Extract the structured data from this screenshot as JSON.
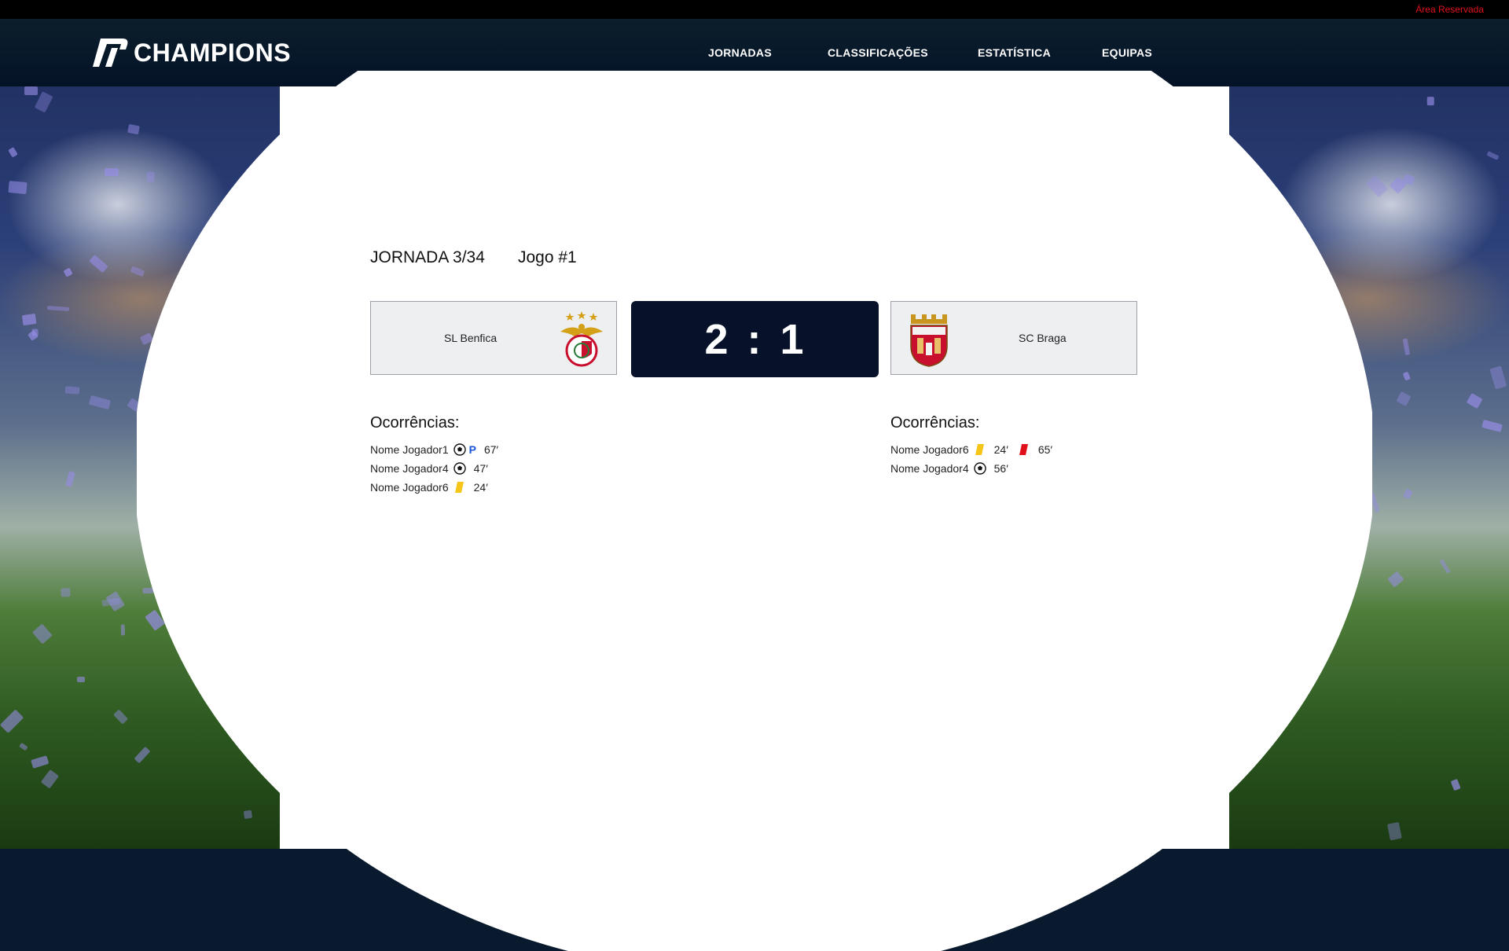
{
  "topbar": {
    "reserved_label": "Área Reservada"
  },
  "header": {
    "logo_text": "CHAMPIONS",
    "nav": [
      "JORNADAS",
      "CLASSIFICAÇÕES",
      "ESTATÍSTICA",
      "EQUIPAS"
    ]
  },
  "match": {
    "jornada_label": "JORNADA 3/34",
    "game_label": "Jogo #1",
    "home_team": "SL Benfica",
    "away_team": "SC Braga",
    "home_score": "2",
    "separator": ":",
    "away_score": "1"
  },
  "occurrences": {
    "title": "Ocorrências:",
    "home": [
      {
        "player": "Nome Jogador1",
        "events": [
          {
            "icon": "goal-ball-icon",
            "penalty": "P",
            "minute": "67′"
          }
        ]
      },
      {
        "player": "Nome Jogador4",
        "events": [
          {
            "icon": "goal-ball-icon",
            "minute": "47′"
          }
        ]
      },
      {
        "player": "Nome Jogador6",
        "events": [
          {
            "icon": "yellow-card-icon",
            "minute": "24′"
          }
        ]
      }
    ],
    "away": [
      {
        "player": "Nome Jogador6",
        "events": [
          {
            "icon": "yellow-card-icon",
            "minute": "24′"
          },
          {
            "icon": "red-card-icon",
            "minute": "65′"
          }
        ]
      },
      {
        "player": "Nome Jogador4",
        "events": [
          {
            "icon": "goal-ball-icon",
            "minute": "56′"
          }
        ]
      }
    ]
  },
  "colors": {
    "header_bg": "#07182a",
    "score_bg": "#07122a",
    "reserved_red": "#e0101b",
    "yellow_card": "#f5c518",
    "red_card": "#e0101b",
    "penalty_blue": "#1a56d6"
  }
}
